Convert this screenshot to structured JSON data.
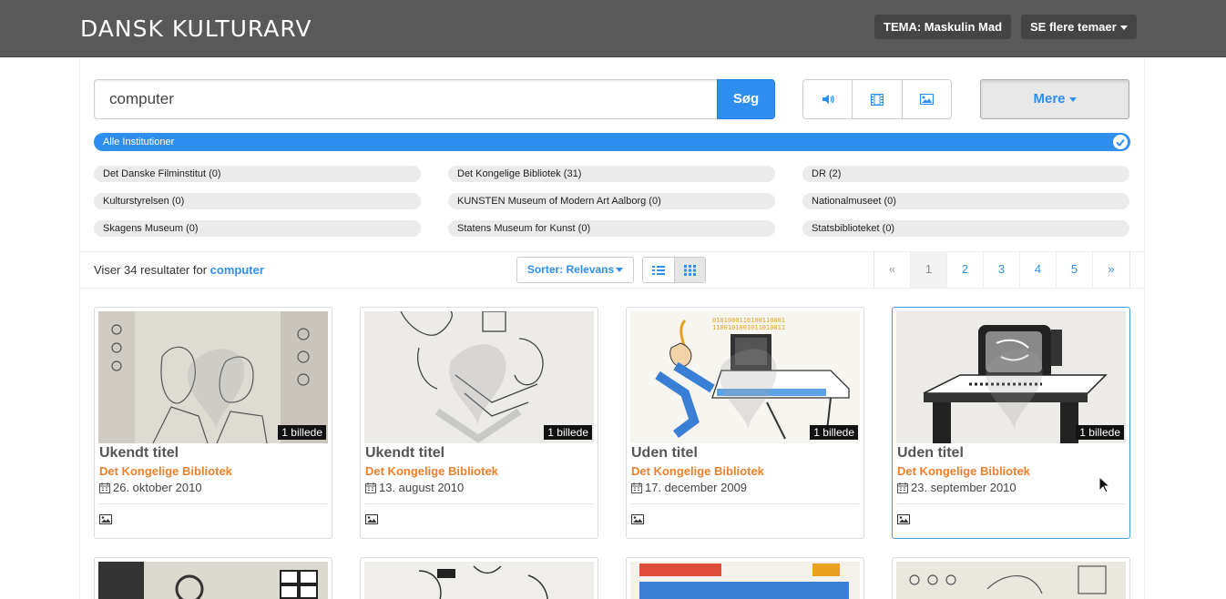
{
  "header": {
    "logo": "DANSK KULTURARV",
    "theme_label": "TEMA: Maskulin Mad",
    "more_themes_label": "SE flere temaer"
  },
  "search": {
    "query": "computer",
    "button_label": "Søg",
    "media_filters": [
      "audio-icon",
      "film-icon",
      "image-icon"
    ],
    "more_label": "Mere"
  },
  "institutions": {
    "all_label": "Alle Institutioner",
    "items": [
      "Det Danske Filminstitut (0)",
      "Det Kongelige Bibliotek (31)",
      "DR (2)",
      "Kulturstyrelsen (0)",
      "KUNSTEN Museum of Modern Art Aalborg (0)",
      "Nationalmuseet (0)",
      "Skagens Museum (0)",
      "Statens Museum for Kunst (0)",
      "Statsbiblioteket (0)"
    ]
  },
  "results": {
    "prefix": "Viser 34 resultater for",
    "query": "computer",
    "sort_label": "Sorter: Relevans",
    "pagination": [
      "«",
      "1",
      "2",
      "3",
      "4",
      "5",
      "»"
    ],
    "active_page": "1"
  },
  "cards": [
    {
      "title": "Ukendt titel",
      "org": "Det Kongelige Bibliotek",
      "date": "26. oktober 2010",
      "badge": "1 billede"
    },
    {
      "title": "Ukendt titel",
      "org": "Det Kongelige Bibliotek",
      "date": "13. august 2010",
      "badge": "1 billede"
    },
    {
      "title": "Uden titel",
      "org": "Det Kongelige Bibliotek",
      "date": "17. december 2009",
      "badge": "1 billede"
    },
    {
      "title": "Uden titel",
      "org": "Det Kongelige Bibliotek",
      "date": "23. september 2010",
      "badge": "1 billede"
    }
  ],
  "colors": {
    "accent": "#2f8ff0",
    "org_orange": "#f07f2a",
    "topbar": "#595959"
  }
}
